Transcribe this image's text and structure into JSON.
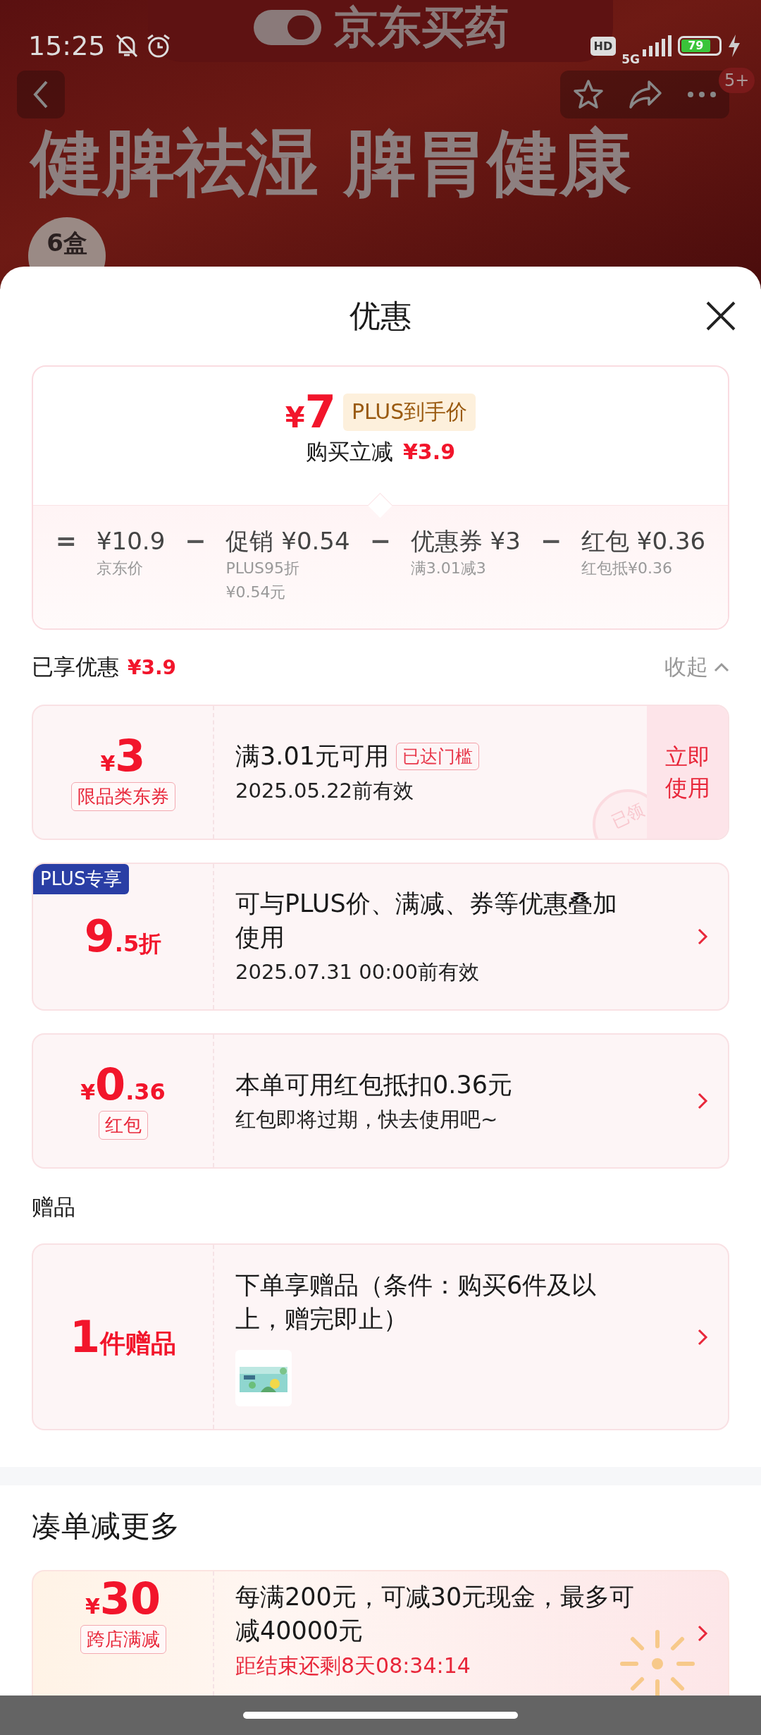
{
  "status_bar": {
    "time": "15:25",
    "hd_badge": "HD",
    "network": "5G",
    "battery": "79"
  },
  "background_page": {
    "logo": "京东买药",
    "headline": "健脾祛湿 脾胃健康",
    "badge": "6盒",
    "cart_count": "5+"
  },
  "sheet": {
    "title": "优惠"
  },
  "price_summary": {
    "currency": "¥",
    "price": "7",
    "price_tag": "PLUS到手价",
    "saving_label": "购买立减",
    "saving": "¥3.9",
    "formula": [
      {
        "kind": "op",
        "text": "="
      },
      {
        "kind": "term",
        "title": "¥10.9",
        "notes": [
          "京东价"
        ]
      },
      {
        "kind": "op",
        "text": "−"
      },
      {
        "kind": "term",
        "title": "促销 ¥0.54",
        "notes": [
          "PLUS95折",
          "¥0.54元"
        ]
      },
      {
        "kind": "op",
        "text": "−"
      },
      {
        "kind": "term",
        "title": "优惠券 ¥3",
        "notes": [
          "满3.01减3"
        ]
      },
      {
        "kind": "op",
        "text": "−"
      },
      {
        "kind": "term",
        "title": "红包 ¥0.36",
        "notes": [
          "红包抵¥0.36"
        ]
      }
    ]
  },
  "enjoyed": {
    "label": "已享优惠",
    "amount": "¥3.9",
    "toggle": "收起",
    "expanded": true
  },
  "offers": [
    {
      "kind": "coupon",
      "currency": "¥",
      "value": "3",
      "tag": "限品类东券",
      "title": "满3.01元可用",
      "badge": "已达门槛",
      "subtitle": "2025.05.22前有效",
      "action": "立即使用",
      "stamp": "已领"
    },
    {
      "kind": "discount",
      "corner": "PLUS专享",
      "value": "9",
      "decimal": ".5",
      "unit": "折",
      "title": "可与PLUS价、满减、券等优惠叠加使用",
      "subtitle": "2025.07.31 00:00前有效"
    },
    {
      "kind": "redpacket",
      "currency": "¥",
      "value": "0",
      "decimal": ".36",
      "tag": "红包",
      "title": "本单可用红包抵扣0.36元",
      "subtitle": "红包即将过期，快去使用吧~"
    }
  ],
  "gifts": {
    "heading": "赠品",
    "cards": [
      {
        "value": "1",
        "unit": "件赠品",
        "title": "下单享赠品（条件：购买6件及以上，赠完即止）"
      }
    ]
  },
  "more": {
    "heading": "凑单减更多",
    "promos": [
      {
        "kind": "promo",
        "currency": "¥",
        "value": "30",
        "tag": "跨店满减",
        "title": "每满200元，可减30元现金，最多可减40000元",
        "countdown": "距结束还剩8天08:34:14"
      }
    ]
  }
}
